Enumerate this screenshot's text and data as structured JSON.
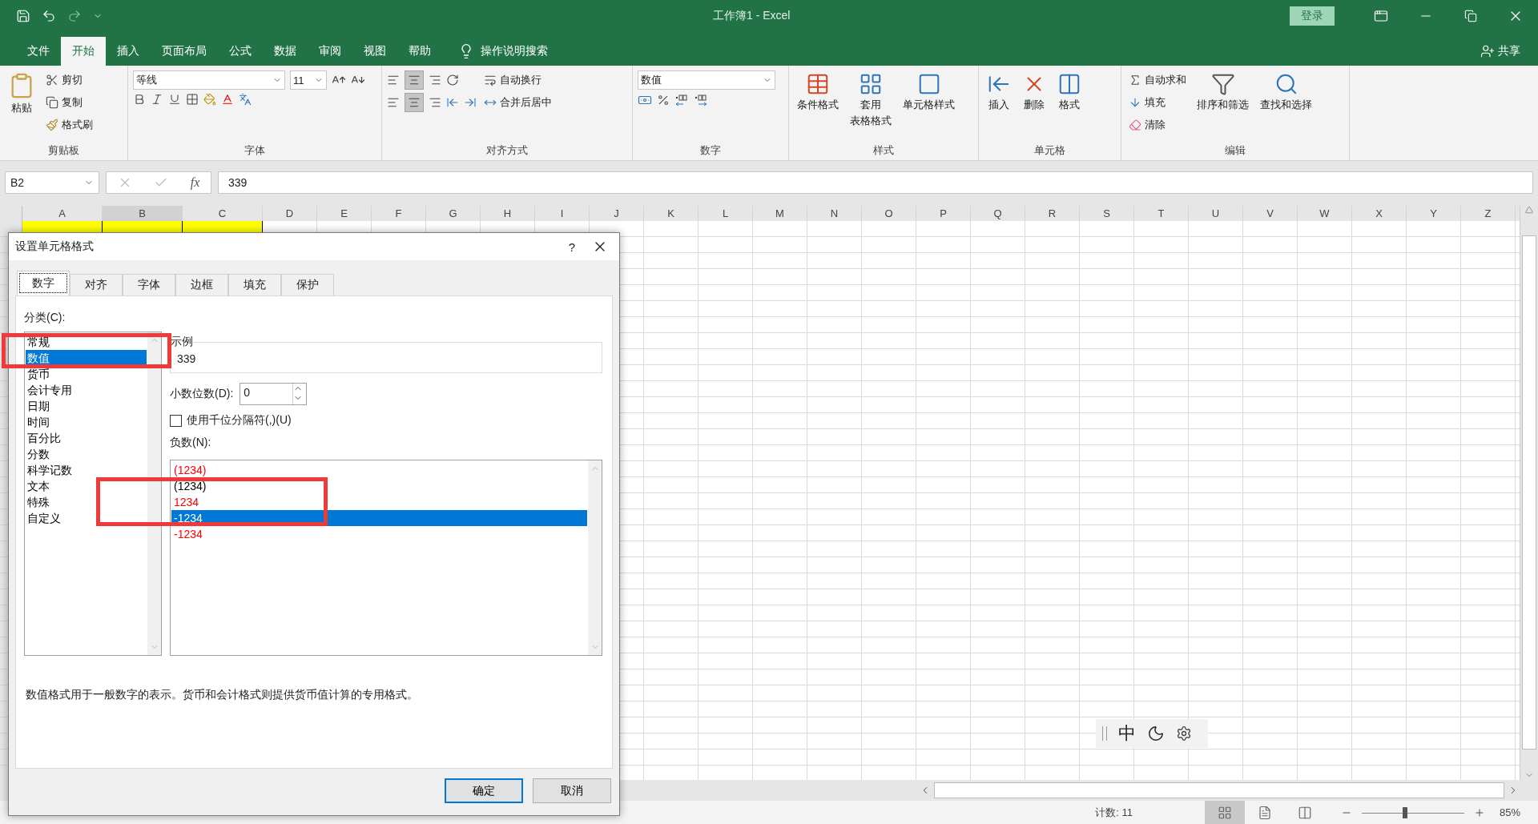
{
  "window": {
    "title": "工作簿1  -  Excel",
    "sign_in": "登录"
  },
  "menu_tabs": [
    {
      "label": "文件",
      "selected": false
    },
    {
      "label": "开始",
      "selected": true
    },
    {
      "label": "插入",
      "selected": false
    },
    {
      "label": "页面布局",
      "selected": false
    },
    {
      "label": "公式",
      "selected": false
    },
    {
      "label": "数据",
      "selected": false
    },
    {
      "label": "审阅",
      "selected": false
    },
    {
      "label": "视图",
      "selected": false
    },
    {
      "label": "帮助",
      "selected": false
    }
  ],
  "tell_me": "操作说明搜索",
  "share": "共享",
  "ribbon": {
    "clipboard": {
      "paste": "粘贴",
      "cut": "剪切",
      "copy": "复制",
      "format_painter": "格式刷",
      "label": "剪贴板"
    },
    "font": {
      "font_name": "等线",
      "font_size": "11",
      "label": "字体"
    },
    "alignment": {
      "wrap_text": "自动换行",
      "merge": "合并后居中",
      "label": "对齐方式"
    },
    "number": {
      "format": "数值",
      "label": "数字"
    },
    "styles": {
      "conditional": "条件格式",
      "format_table": "套用",
      "format_table_2": "表格格式",
      "cell_styles": "单元格样式",
      "label": "样式"
    },
    "cells": {
      "insert": "插入",
      "delete": "删除",
      "format": "格式",
      "label": "单元格"
    },
    "editing": {
      "autosum": "自动求和",
      "fill": "填充",
      "clear": "清除",
      "sort": "排序和筛选",
      "find": "查找和选择",
      "label": "编辑"
    }
  },
  "formula_bar": {
    "name_box": "B2",
    "function_button": "fx",
    "formula": "339"
  },
  "sheet": {
    "columns": [
      {
        "label": "A",
        "selected": false,
        "filled": true
      },
      {
        "label": "B",
        "selected": true,
        "filled": true
      },
      {
        "label": "C",
        "selected": false,
        "filled": true
      },
      {
        "label": "D",
        "selected": false,
        "filled": false
      },
      {
        "label": "E",
        "selected": false,
        "filled": false
      },
      {
        "label": "F",
        "selected": false,
        "filled": false
      },
      {
        "label": "G",
        "selected": false,
        "filled": false
      },
      {
        "label": "H",
        "selected": false,
        "filled": false
      },
      {
        "label": "I",
        "selected": false,
        "filled": false
      },
      {
        "label": "J",
        "selected": false,
        "filled": false
      },
      {
        "label": "K",
        "selected": false,
        "filled": false
      },
      {
        "label": "L",
        "selected": false,
        "filled": false
      },
      {
        "label": "M",
        "selected": false,
        "filled": false
      },
      {
        "label": "N",
        "selected": false,
        "filled": false
      },
      {
        "label": "O",
        "selected": false,
        "filled": false
      },
      {
        "label": "P",
        "selected": false,
        "filled": false
      },
      {
        "label": "Q",
        "selected": false,
        "filled": false
      },
      {
        "label": "R",
        "selected": false,
        "filled": false
      },
      {
        "label": "S",
        "selected": false,
        "filled": false
      },
      {
        "label": "T",
        "selected": false,
        "filled": false
      },
      {
        "label": "U",
        "selected": false,
        "filled": false
      },
      {
        "label": "V",
        "selected": false,
        "filled": false
      },
      {
        "label": "W",
        "selected": false,
        "filled": false
      },
      {
        "label": "X",
        "selected": false,
        "filled": false
      },
      {
        "label": "Y",
        "selected": false,
        "filled": false
      },
      {
        "label": "Z",
        "selected": false,
        "filled": false
      }
    ]
  },
  "dialog": {
    "title": "设置单元格格式",
    "help": "?",
    "tabs": [
      {
        "label": "数字",
        "selected": true
      },
      {
        "label": "对齐",
        "selected": false
      },
      {
        "label": "字体",
        "selected": false
      },
      {
        "label": "边框",
        "selected": false
      },
      {
        "label": "填充",
        "selected": false
      },
      {
        "label": "保护",
        "selected": false
      }
    ],
    "category_label": "分类(C):",
    "categories": [
      {
        "label": "常规",
        "selected": false
      },
      {
        "label": "数值",
        "selected": true
      },
      {
        "label": "货币",
        "selected": false
      },
      {
        "label": "会计专用",
        "selected": false
      },
      {
        "label": "日期",
        "selected": false
      },
      {
        "label": "时间",
        "selected": false
      },
      {
        "label": "百分比",
        "selected": false
      },
      {
        "label": "分数",
        "selected": false
      },
      {
        "label": "科学记数",
        "selected": false
      },
      {
        "label": "文本",
        "selected": false
      },
      {
        "label": "特殊",
        "selected": false
      },
      {
        "label": "自定义",
        "selected": false
      }
    ],
    "sample": {
      "label": "示例",
      "value": "339"
    },
    "decimals": {
      "label": "小数位数(D):",
      "value": "0"
    },
    "thousands": {
      "label": "使用千位分隔符(,)(U)",
      "checked": false
    },
    "negative_label": "负数(N):",
    "negative_options": [
      {
        "text": "(1234)",
        "color": "#ff0000",
        "selected": false
      },
      {
        "text": "(1234)",
        "color": "#000000",
        "selected": false
      },
      {
        "text": "1234",
        "color": "#ff0000",
        "selected": false
      },
      {
        "text": "-1234",
        "selected": true
      },
      {
        "text": "-1234",
        "color": "#ff0000",
        "selected": false
      }
    ],
    "description": "数值格式用于一般数字的表示。货币和会计格式则提供货币值计算的专用格式。",
    "buttons": [
      {
        "label": "确定",
        "kind": "primary"
      },
      {
        "label": "取消",
        "kind": "secondary"
      }
    ]
  },
  "ime_bar": {
    "mode": "中"
  },
  "status_bar": {
    "count": "计数: 11",
    "zoom": {
      "level": 0.42,
      "reading": "85%"
    }
  }
}
